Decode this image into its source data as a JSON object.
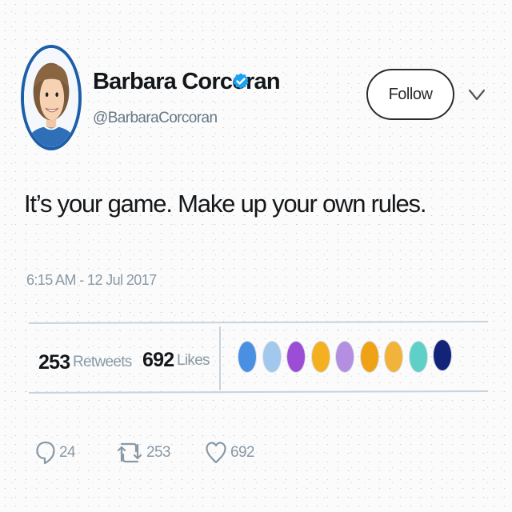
{
  "user": {
    "display_name": "Barbara Corcoran",
    "handle": "@BarbaraCorcoran",
    "verified_icon": "verified-badge-icon",
    "avatar_border_color": "#1d5ea8"
  },
  "header": {
    "follow_label": "Follow",
    "menu_icon": "chevron-down-icon"
  },
  "tweet": {
    "text": "It’s your game. Make up your own rules.",
    "timestamp": "6:15 AM - 12 Jul 2017"
  },
  "stats": {
    "retweets_count": "253",
    "retweets_label": "Retweets",
    "likes_count": "692",
    "likes_label": "Likes"
  },
  "likers": [
    {
      "color": "#4a90e2"
    },
    {
      "color": "#a3c8ee"
    },
    {
      "color": "#9b4dd6"
    },
    {
      "color": "#f5b021"
    },
    {
      "color": "#b48ee0"
    },
    {
      "color": "#f0a216"
    },
    {
      "color": "#f2b33a"
    },
    {
      "color": "#5fd0c7"
    },
    {
      "color": "#13237a"
    }
  ],
  "actions": {
    "reply_count": "24",
    "retweet_count": "253",
    "like_count": "692"
  },
  "colors": {
    "verified": "#1da1f2",
    "text_primary": "#14171a",
    "text_secondary": "#8899a6"
  }
}
